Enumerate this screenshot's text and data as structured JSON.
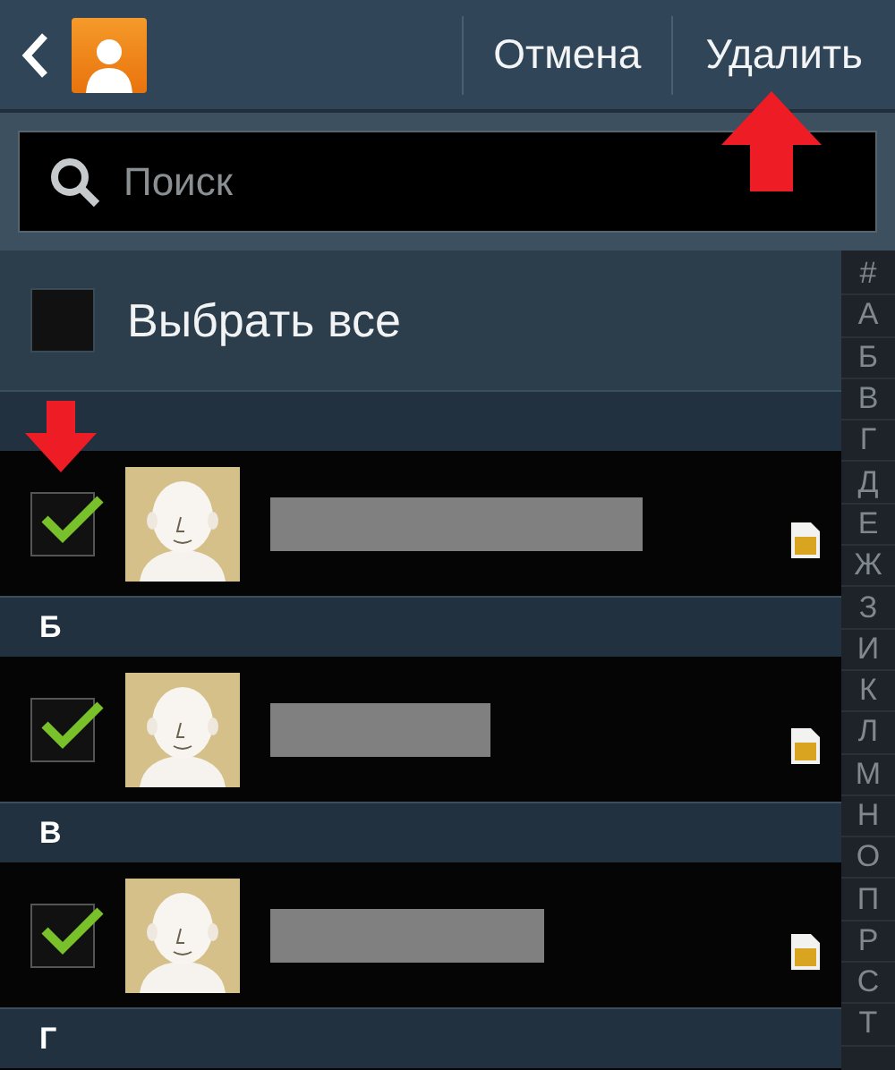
{
  "header": {
    "cancel": "Отмена",
    "delete": "Удалить"
  },
  "search": {
    "placeholder": "Поиск"
  },
  "select_all": {
    "label": "Выбрать все",
    "checked": false
  },
  "sections": [
    {
      "contacts": [
        {
          "checked": true
        }
      ]
    },
    {
      "letter": "Б",
      "contacts": [
        {
          "checked": true
        }
      ]
    },
    {
      "letter": "В",
      "contacts": [
        {
          "checked": true
        }
      ]
    },
    {
      "letter": "Г"
    }
  ],
  "index": [
    "#",
    "А",
    "Б",
    "В",
    "Г",
    "Д",
    "Е",
    "Ж",
    "З",
    "И",
    "К",
    "Л",
    "М",
    "Н",
    "О",
    "П",
    "Р",
    "С",
    "Т"
  ]
}
